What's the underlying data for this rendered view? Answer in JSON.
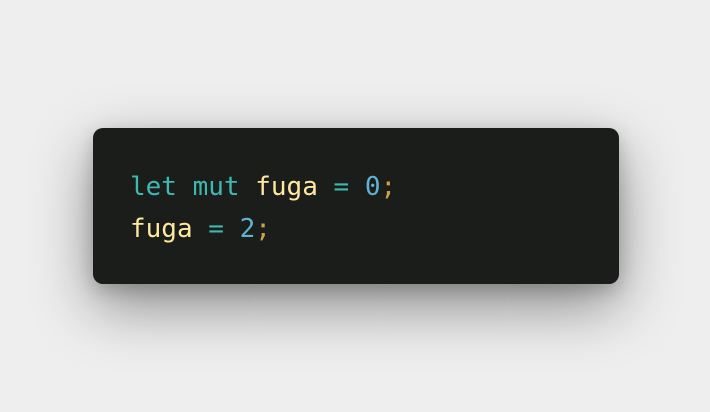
{
  "code": {
    "lines": [
      {
        "tokens": [
          {
            "text": "let",
            "kind": "keyword"
          },
          {
            "text": " ",
            "kind": "space"
          },
          {
            "text": "mut",
            "kind": "keyword"
          },
          {
            "text": " ",
            "kind": "space"
          },
          {
            "text": "fuga",
            "kind": "variable"
          },
          {
            "text": " ",
            "kind": "space"
          },
          {
            "text": "=",
            "kind": "operator"
          },
          {
            "text": " ",
            "kind": "space"
          },
          {
            "text": "0",
            "kind": "number"
          },
          {
            "text": ";",
            "kind": "punctuation"
          }
        ]
      },
      {
        "tokens": [
          {
            "text": "fuga",
            "kind": "variable"
          },
          {
            "text": " ",
            "kind": "space"
          },
          {
            "text": "=",
            "kind": "operator"
          },
          {
            "text": " ",
            "kind": "space"
          },
          {
            "text": "2",
            "kind": "number"
          },
          {
            "text": ";",
            "kind": "punctuation"
          }
        ]
      }
    ]
  },
  "colors": {
    "background": "#eeeeee",
    "card": "#1a1d1a",
    "keyword": "#3fb8b0",
    "variable": "#ffe8a0",
    "operator": "#3fb8b0",
    "number": "#5fb3d2",
    "punctuation": "#c9a34a"
  }
}
